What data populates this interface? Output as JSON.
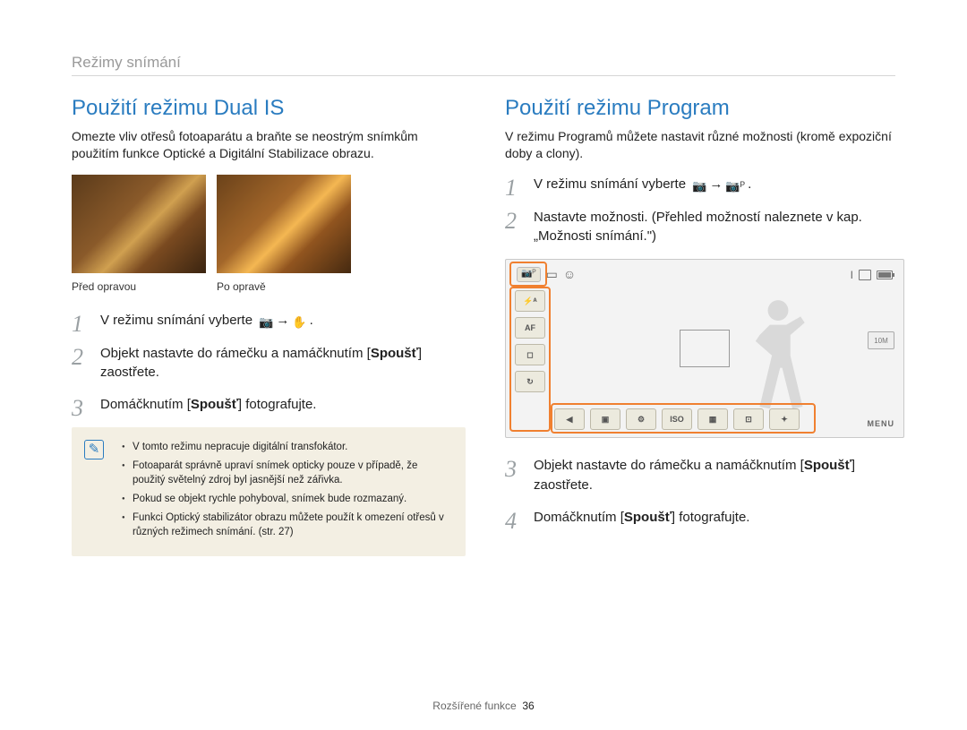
{
  "breadcrumb": "Režimy snímání",
  "left": {
    "heading": "Použití režimu Dual IS",
    "lead": "Omezte vliv otřesů fotoaparátu a braňte se neostrým snímkům použitím funkce Optické a Digitální Stabilizace obrazu.",
    "caption_before": "Před opravou",
    "caption_after": "Po opravě",
    "step1_pre": "V režimu snímání vyberte ",
    "step1_icon1": "📷",
    "step1_arrow": "→",
    "step1_icon2": "✋",
    "step1_post": ".",
    "step2_a": "Objekt nastavte do rámečku a namáčknutím [",
    "step2_b": "Spoušť",
    "step2_c": "] zaostřete.",
    "step3_a": "Domáčknutím [",
    "step3_b": "Spoušť",
    "step3_c": "] fotografujte.",
    "note1": "V tomto režimu nepracuje digitální transfokátor.",
    "note2": "Fotoaparát správně upraví snímek opticky pouze v případě, že použitý světelný zdroj byl jasnější než zářivka.",
    "note3": "Pokud se objekt rychle pohyboval, snímek bude rozmazaný.",
    "note4": "Funkci Optický stabilizátor obrazu můžete použít k omezení otřesů v různých režimech snímání. (str. 27)"
  },
  "right": {
    "heading": "Použití režimu Program",
    "lead": "V režimu Programů můžete nastavit různé možnosti (kromě expoziční doby a clony).",
    "step1_pre": "V režimu snímání vyberte ",
    "step1_icon1": "📷",
    "step1_arrow": "→",
    "step1_icon2": "📷ᴾ",
    "step1_post": ".",
    "step2": "Nastavte možnosti. (Přehled možností naleznete v kap. „Možnosti snímání.\")",
    "step3_a": "Objekt nastavte do rámečku a namáčknutím [",
    "step3_b": "Spoušť",
    "step3_c": "] zaostřete.",
    "step4_a": "Domáčknutím [",
    "step4_b": "Spoušť",
    "step4_c": "] fotografujte."
  },
  "lcd": {
    "top_icons": [
      "📷ᴾ",
      "▭",
      "☺"
    ],
    "batt_text": "I",
    "left_buttons": [
      "⚡ᴬ",
      "AF",
      "◻",
      "↻"
    ],
    "bottom_buttons": [
      "◀",
      "▣",
      "⚙",
      "ISO",
      "▦",
      "⊡",
      "✦"
    ],
    "size_label": "10M",
    "menu_label": "MENU"
  },
  "footer": {
    "section": "Rozšířené funkce",
    "page": "36"
  }
}
